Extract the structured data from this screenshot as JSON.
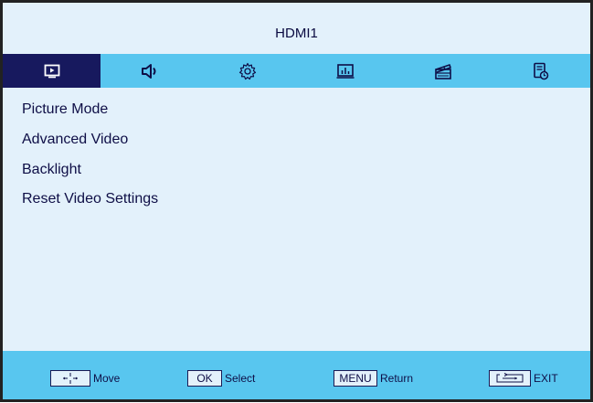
{
  "header": {
    "title": "HDMI1"
  },
  "tabs": [
    {
      "icon": "picture-icon",
      "active": true
    },
    {
      "icon": "speaker-icon",
      "active": false
    },
    {
      "icon": "gear-icon",
      "active": false
    },
    {
      "icon": "chart-icon",
      "active": false
    },
    {
      "icon": "clapperboard-icon",
      "active": false
    },
    {
      "icon": "document-clock-icon",
      "active": false
    }
  ],
  "menu": {
    "items": [
      {
        "label": "Picture Mode"
      },
      {
        "label": "Advanced Video"
      },
      {
        "label": "Backlight"
      },
      {
        "label": "Reset Video Settings"
      }
    ]
  },
  "footer": {
    "move": {
      "key": "",
      "label": "Move",
      "icon": "dpad-icon"
    },
    "select": {
      "key": "OK",
      "label": "Select"
    },
    "return": {
      "key": "MENU",
      "label": "Return"
    },
    "exit": {
      "key": "",
      "label": "EXIT",
      "icon": "exit-key-icon"
    }
  },
  "colors": {
    "background": "#e3f1fb",
    "tab_bar": "#58c6ef",
    "active_tab": "#17195e",
    "text": "#0e0e46",
    "border": "#222222"
  }
}
